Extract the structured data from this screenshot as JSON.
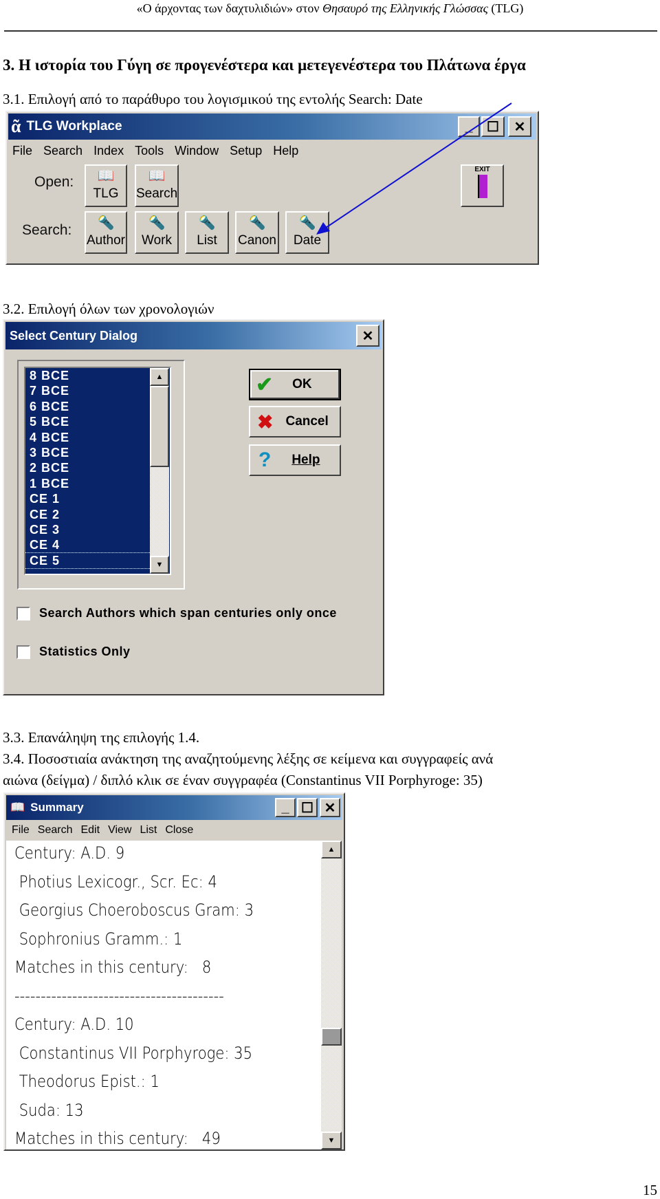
{
  "page_header": {
    "normal": "«Ο άρχοντας των δαχτυλιδιών» στον ",
    "italic": "Θησαυρό της Ελληνικής Γλώσσας",
    "tail": " (TLG)"
  },
  "heading": "3. Η ιστορία του Γύγη σε προγενέστερα και μετεγενέστερα του Πλάτωνα έργα",
  "s31": "3.1. Επιλογή από το παράθυρο του λογισμικού της εντολής Search: Date",
  "s32": "3.2. Επιλογή όλων των χρονολογιών",
  "s33": "3.3. Επανάληψη της επιλογής 1.4.",
  "s34a": "3.4. Ποσοστιαία ανάκτηση της αναζητούμενης λέξης σε κείμενα και συγγραφείς ανά",
  "s34b": "αιώνα (δείγμα) / διπλό κλικ σε έναν συγγραφέα (Constantinus VII Porphyroge: 35)",
  "page_number": "15",
  "tlg": {
    "title": "TLG Workplace",
    "menu": [
      "File",
      "Search",
      "Index",
      "Tools",
      "Window",
      "Setup",
      "Help"
    ],
    "open_label": "Open:",
    "search_label": "Search:",
    "open_buttons": [
      "TLG",
      "Search"
    ],
    "search_buttons": [
      "Author",
      "Work",
      "List",
      "Canon",
      "Date"
    ],
    "exit_label": "EXIT",
    "arrow_color": "#1010d0"
  },
  "dialog": {
    "title": "Select Century Dialog",
    "items": [
      "8 BCE",
      "7 BCE",
      "6 BCE",
      "5 BCE",
      "4 BCE",
      "3 BCE",
      "2 BCE",
      "1 BCE",
      "CE 1",
      "CE 2",
      "CE 3",
      "CE 4",
      "CE 5"
    ],
    "ok": "OK",
    "cancel": "Cancel",
    "help": "Help",
    "check1": "Search Authors which span centuries only once",
    "check2": "Statistics Only"
  },
  "summary": {
    "title": "Summary",
    "menu": [
      "File",
      "Search",
      "Edit",
      "View",
      "List",
      "Close"
    ],
    "lines": [
      "Century: A.D. 9",
      " Photius Lexicogr., Scr. Ec: 4",
      " Georgius Choeroboscus Gram: 3",
      " Sophronius Gramm.: 1",
      "Matches in this century:   8",
      "----------------------------------------",
      "Century: A.D. 10",
      " Constantinus VII Porphyroge: 35",
      " Theodorus Epist.: 1",
      " Suda: 13",
      "Matches in this century:   49"
    ]
  }
}
